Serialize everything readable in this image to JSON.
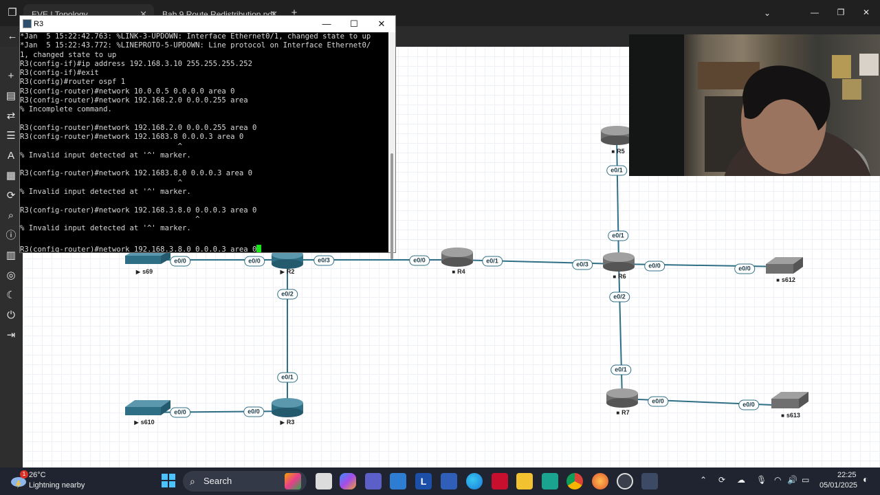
{
  "browser": {
    "tabs": [
      {
        "label": "EVE | Topology"
      },
      {
        "label": "Bab 9 Route Redistribution.pdf"
      }
    ],
    "new_tab_icon": "plus-icon"
  },
  "terminal": {
    "title": "R3",
    "lines": [
      "*Jan  5 15:22:42.763: %LINK-3-UPDOWN: Interface Ethernet0/1, changed state to up",
      "*Jan  5 15:22:43.772: %LINEPROTO-5-UPDOWN: Line protocol on Interface Ethernet0/",
      "1, changed state to up",
      "R3(config-if)#ip address 192.168.3.10 255.255.255.252",
      "R3(config-if)#exit",
      "R3(config)#router ospf 1",
      "R3(config-router)#network 10.0.0.5 0.0.0.0 area 0",
      "R3(config-router)#network 192.168.2.0 0.0.0.255 area",
      "% Incomplete command.",
      "",
      "R3(config-router)#network 192.168.2.0 0.0.0.255 area 0",
      "R3(config-router)#network 192.1683.8 0.0.0.3 area 0",
      "                                    ^",
      "% Invalid input detected at '^' marker.",
      "",
      "R3(config-router)#network 192.1683.8.0 0.0.0.3 area 0",
      "                                    ^",
      "% Invalid input detected at '^' marker.",
      "",
      "R3(config-router)#network 192.168.3.8.0 0.0.0.3 area 0",
      "                                        ^",
      "% Invalid input detected at '^' marker.",
      "",
      "R3(config-router)#network 192.168.3.8.0 0.0.0.3 area 0"
    ]
  },
  "topology": {
    "nodes": {
      "s69": "s69",
      "R2": "R2",
      "R3": "R3",
      "R4": "R4",
      "R5": "R5",
      "R6": "R6",
      "R7": "R7",
      "s610": "s610",
      "s612": "s612",
      "s613": "s613"
    },
    "ports": {
      "s69_e00": "e0/0",
      "r2_e00": "e0/0",
      "r2_e03": "e0/3",
      "r4_e00": "e0/0",
      "r4_e01": "e0/1",
      "r6_e03": "e0/3",
      "r6_e00": "e0/0",
      "s612_e00": "e0/0",
      "r5_e01": "e0/1",
      "r6_e01": "e0/1",
      "r2_e02": "e0/2",
      "r3_e01": "e0/1",
      "s610_e00": "e0/0",
      "r3_e00": "e0/0",
      "r6_e02": "e0/2",
      "r7_e01": "e0/1",
      "r7_e00": "e0/0",
      "s613_e00": "e0/0"
    },
    "colors": {
      "link": "#2f6f86",
      "running_router": "#2f6f86",
      "stopped_router": "#6f6f6f"
    }
  },
  "taskbar": {
    "weather_temp": "26°C",
    "weather_desc": "Lightning nearby",
    "weather_badge": "1",
    "search_label": "Search",
    "time": "22:25",
    "date": "05/01/2025"
  }
}
